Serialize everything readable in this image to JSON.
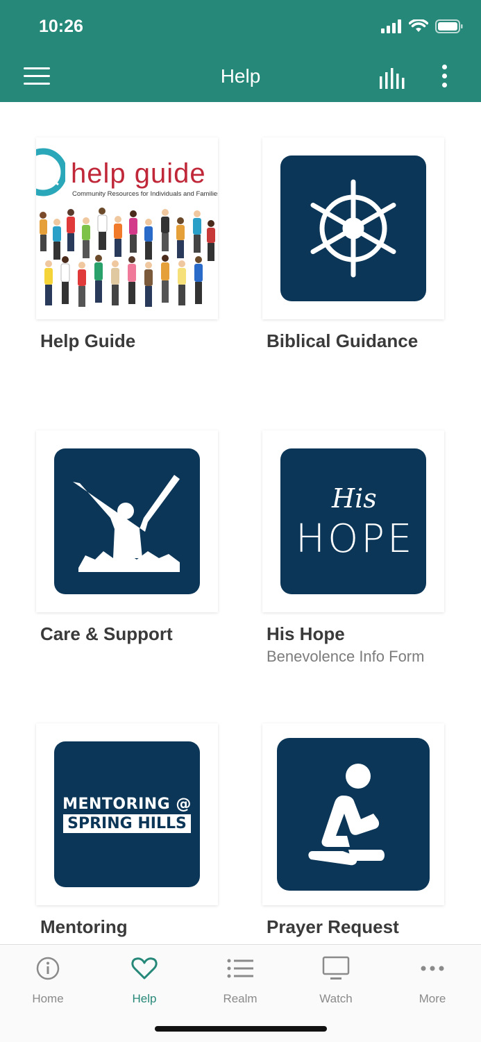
{
  "status_bar": {
    "time": "10:26"
  },
  "header": {
    "title": "Help",
    "background": "#268878"
  },
  "icons": {
    "menu": "hamburger-icon",
    "stats": "bar-chart-icon",
    "more": "more-vertical-icon"
  },
  "tiles": [
    {
      "title": "Help Guide",
      "image": {
        "headline": "help guide",
        "tagline": "Community Resources for Individuals and Families"
      }
    },
    {
      "title": "Biblical Guidance",
      "icon": "ship-wheel-icon"
    },
    {
      "title": "Care & Support",
      "icon": "raised-arms-silhouette-icon"
    },
    {
      "title": "His Hope",
      "subtitle": "Benevolence Info Form",
      "image": {
        "script": "His",
        "word": "HOPE"
      }
    },
    {
      "title": "Mentoring",
      "image": {
        "line1": "MENTORING @",
        "line2": "SPRING HILLS"
      }
    },
    {
      "title": "Prayer Request",
      "icon": "praying-person-icon"
    }
  ],
  "tabbar": {
    "active_color": "#268878",
    "items": [
      {
        "label": "Home",
        "icon": "info-circle-icon"
      },
      {
        "label": "Help",
        "icon": "heart-icon",
        "active": true
      },
      {
        "label": "Realm",
        "icon": "list-icon"
      },
      {
        "label": "Watch",
        "icon": "monitor-icon"
      },
      {
        "label": "More",
        "icon": "more-horizontal-icon"
      }
    ]
  }
}
